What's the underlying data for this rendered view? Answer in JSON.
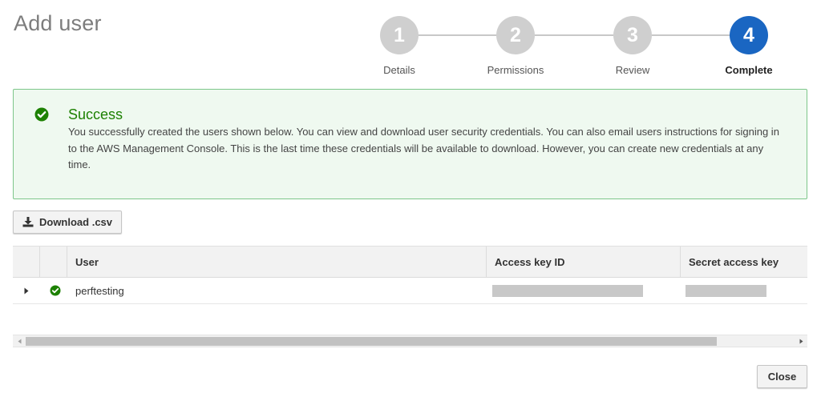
{
  "page": {
    "title": "Add user"
  },
  "wizard": {
    "steps": [
      {
        "number": "1",
        "label": "Details",
        "active": false
      },
      {
        "number": "2",
        "label": "Permissions",
        "active": false
      },
      {
        "number": "3",
        "label": "Review",
        "active": false
      },
      {
        "number": "4",
        "label": "Complete",
        "active": true
      }
    ]
  },
  "alert": {
    "icon": "check-circle-icon",
    "title": "Success",
    "message": "You successfully created the users shown below. You can view and download user security credentials. You can also email users instructions for signing in to the AWS Management Console. This is the last time these credentials will be available to download. However, you can create new credentials at any time."
  },
  "toolbar": {
    "download_label": "Download .csv",
    "download_icon": "download-icon"
  },
  "table": {
    "columns": [
      "User",
      "Access key ID",
      "Secret access key"
    ],
    "rows": [
      {
        "user": "perftesting",
        "status_icon": "check-circle-icon",
        "access_key_id": "",
        "secret_access_key": ""
      }
    ]
  },
  "footer": {
    "close_label": "Close"
  },
  "colors": {
    "active_step": "#1a66c2",
    "inactive_step": "#cfcfcf",
    "success": "#1d8102",
    "alert_bg": "#eff9f0",
    "alert_border": "#7dc68a"
  }
}
